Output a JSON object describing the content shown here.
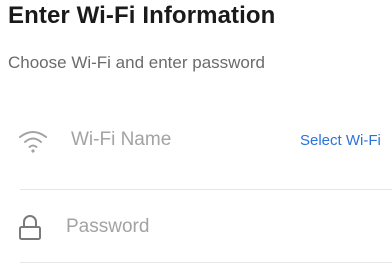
{
  "header": {
    "title": "Enter Wi-Fi Information",
    "subtitle": "Choose Wi-Fi and enter password"
  },
  "wifi_field": {
    "placeholder": "Wi-Fi Name",
    "icon": "wifi-icon",
    "action_label": "Select Wi-Fi"
  },
  "password_field": {
    "placeholder": "Password",
    "icon": "lock-icon"
  },
  "colors": {
    "title": "#1a1a1a",
    "subtitle": "#6b6b6b",
    "placeholder": "#a3a3a3",
    "link": "#2a74d9",
    "divider": "#e6e6e6"
  }
}
